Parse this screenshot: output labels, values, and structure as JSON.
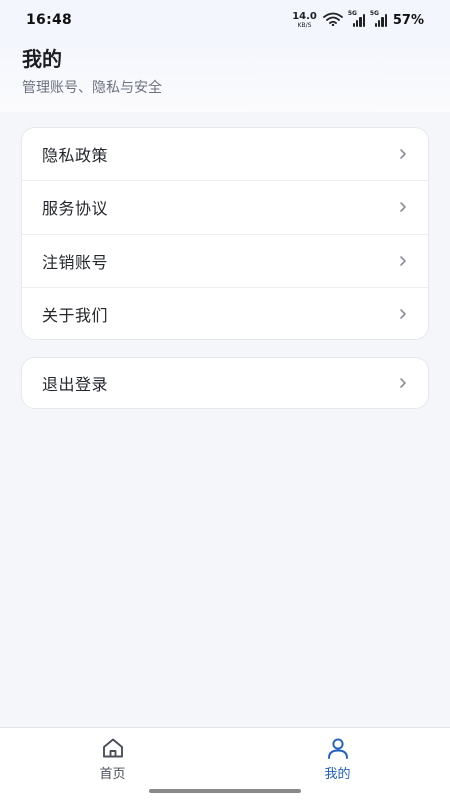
{
  "status_bar": {
    "time": "16:48",
    "net_speed_value": "14.0",
    "net_speed_unit": "KB/S",
    "signal1_tag": "5G",
    "signal2_tag": "5G",
    "battery": "57%",
    "icons": [
      "wifi-icon",
      "signal-icon",
      "signal-icon"
    ]
  },
  "header": {
    "title": "我的",
    "subtitle": "管理账号、隐私与安全"
  },
  "menu": {
    "items": [
      {
        "label": "隐私政策",
        "icon": "chevron-right-icon"
      },
      {
        "label": "服务协议",
        "icon": "chevron-right-icon"
      },
      {
        "label": "注销账号",
        "icon": "chevron-right-icon"
      },
      {
        "label": "关于我们",
        "icon": "chevron-right-icon"
      }
    ]
  },
  "logout": {
    "label": "退出登录",
    "icon": "chevron-right-icon"
  },
  "bottom_nav": {
    "tabs": [
      {
        "label": "首页",
        "icon": "home-icon",
        "active": false
      },
      {
        "label": "我的",
        "icon": "user-icon",
        "active": true
      }
    ]
  },
  "colors": {
    "accent": "#1f5fbf",
    "background": "#f5f6fa",
    "card": "#ffffff"
  }
}
